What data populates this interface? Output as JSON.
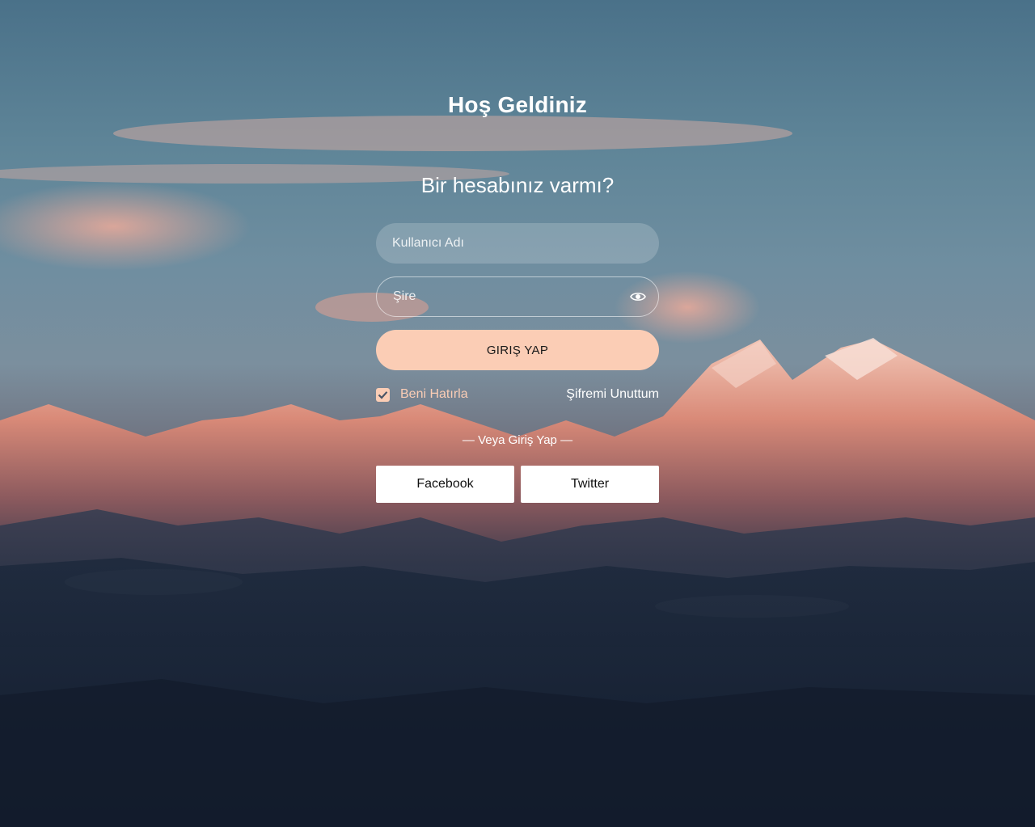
{
  "login": {
    "title": "Hoş Geldiniz",
    "subtitle": "Bir hesabınız varmı?",
    "username_placeholder": "Kullanıcı Adı",
    "password_placeholder": "Şire",
    "login_button": "GIRIŞ YAP",
    "remember_label": "Beni Hatırla",
    "remember_checked": true,
    "forgot_link": "Şifremi Unuttum",
    "or_label": "— Veya Giriş Yap —",
    "facebook_button": "Facebook",
    "twitter_button": "Twitter"
  },
  "icons": {
    "password_toggle": "eye-icon",
    "checkbox": "check-icon"
  },
  "colors": {
    "accent": "#fbcdb5",
    "button_text": "#1a1a1a",
    "social_bg": "#ffffff"
  }
}
